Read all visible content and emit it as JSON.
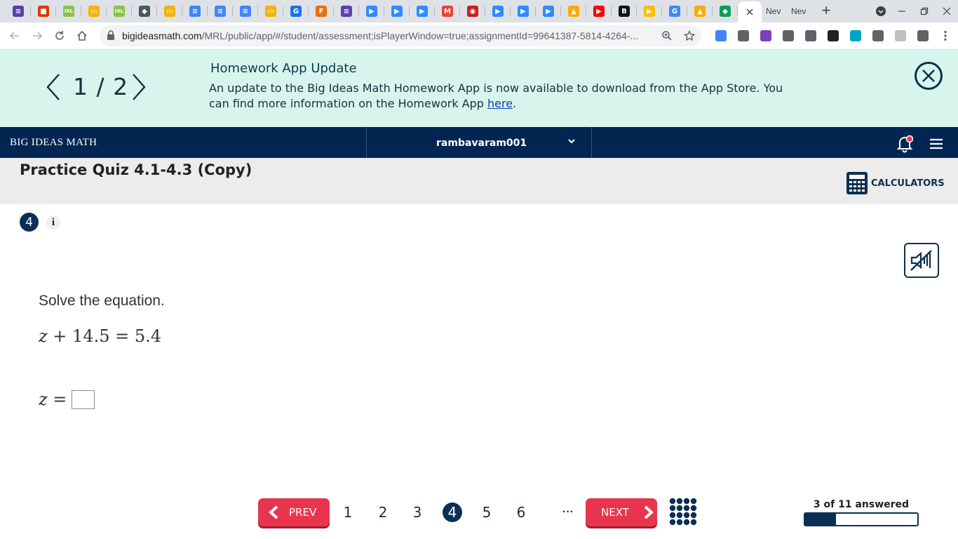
{
  "browser": {
    "tabs": [
      {
        "icon": "bookmark-list-icon",
        "color": "#5b3fb0",
        "glyph": "≡"
      },
      {
        "icon": "office-icon",
        "color": "#d83b01",
        "glyph": "■"
      },
      {
        "icon": "ixl-icon",
        "color": "#8bc34a",
        "glyph": "IXL"
      },
      {
        "icon": "slides-icon",
        "color": "#f4b400",
        "glyph": "▭"
      },
      {
        "icon": "ixl-icon",
        "color": "#8bc34a",
        "glyph": "IXL"
      },
      {
        "icon": "layers-icon",
        "color": "#455a64",
        "glyph": "◆"
      },
      {
        "icon": "slides-icon",
        "color": "#f4b400",
        "glyph": "▭"
      },
      {
        "icon": "docs-icon",
        "color": "#4285f4",
        "glyph": "≡"
      },
      {
        "icon": "docs-icon",
        "color": "#4285f4",
        "glyph": "≡"
      },
      {
        "icon": "docs-icon",
        "color": "#4285f4",
        "glyph": "≡"
      },
      {
        "icon": "slides-icon",
        "color": "#f4b400",
        "glyph": "▭"
      },
      {
        "icon": "g-icon",
        "color": "#1a73e8",
        "glyph": "G"
      },
      {
        "icon": "f-icon",
        "color": "#e8710a",
        "glyph": "F"
      },
      {
        "icon": "list-icon",
        "color": "#5b3fb0",
        "glyph": "≡"
      },
      {
        "icon": "zoom-icon",
        "color": "#2d8cff",
        "glyph": "▶"
      },
      {
        "icon": "zoom-icon",
        "color": "#2d8cff",
        "glyph": "▶"
      },
      {
        "icon": "zoom-icon",
        "color": "#2d8cff",
        "glyph": "▶"
      },
      {
        "icon": "gmail-icon",
        "color": "#ea4335",
        "glyph": "M"
      },
      {
        "icon": "photos-icon",
        "color": "#c5221f",
        "glyph": "◉"
      },
      {
        "icon": "zoom-icon",
        "color": "#2d8cff",
        "glyph": "▶"
      },
      {
        "icon": "zoom-icon",
        "color": "#2d8cff",
        "glyph": "▶"
      },
      {
        "icon": "zoom-icon",
        "color": "#2d8cff",
        "glyph": "▶"
      },
      {
        "icon": "classroom-icon",
        "color": "#f9ab00",
        "glyph": "▲"
      },
      {
        "icon": "youtube-icon",
        "color": "#ff0000",
        "glyph": "▶"
      },
      {
        "icon": "b-icon",
        "color": "#111111",
        "glyph": "B"
      },
      {
        "icon": "pear-deck-icon",
        "color": "#fbbc04",
        "glyph": "▶"
      },
      {
        "icon": "google-icon",
        "color": "#4285f4",
        "glyph": "G"
      },
      {
        "icon": "classroom-icon",
        "color": "#f9ab00",
        "glyph": "▲"
      },
      {
        "icon": "drive-icon",
        "color": "#0f9d58",
        "glyph": "◆"
      }
    ],
    "tab_new_1": "Nev",
    "tab_new_2": "Nev",
    "url_domain": "bigideasmath.com",
    "url_path": "/MRL/public/app/#/student/assessment;isPlayerWindow=true;assignmentId=99641387-5814-4264-..."
  },
  "banner": {
    "page_current": "1",
    "page_sep": "/",
    "page_total": "2",
    "title": "Homework App Update",
    "body": "An update to the Big Ideas Math Homework App is now available to download from the App Store. You can find more information on the Homework App ",
    "link": "here",
    "period": "."
  },
  "navbar": {
    "brand": "BIG IDEAS MATH",
    "username": "rambavaram001"
  },
  "assignment": {
    "title": "Practice Quiz 4.1-4.3 (Copy)",
    "calculators": "CALCULATORS"
  },
  "question": {
    "number": "4",
    "info": "i",
    "prompt": "Solve the equation.",
    "eq_var": "z",
    "eq_rest": " + 14.5 = 5.4",
    "ans_var": "z",
    "ans_eq": " ="
  },
  "pagination": {
    "prev": "PREV",
    "next": "NEXT",
    "pages": [
      "1",
      "2",
      "3",
      "4",
      "5",
      "6"
    ],
    "current": "4",
    "more": "···",
    "progress_text": "3 of 11 answered",
    "answered": 3,
    "total": 11
  }
}
